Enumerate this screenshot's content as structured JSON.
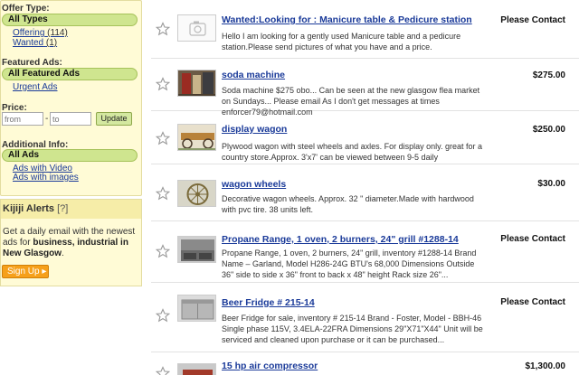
{
  "sidebar": {
    "offer_type": {
      "heading": "Offer Type:",
      "selected": "All Types",
      "options": [
        {
          "label": "Offering",
          "count": "(114)"
        },
        {
          "label": "Wanted",
          "count": "(1)"
        }
      ]
    },
    "featured_ads": {
      "heading": "Featured Ads:",
      "selected": "All Featured Ads",
      "options": [
        {
          "label": "Urgent Ads"
        }
      ]
    },
    "price": {
      "heading": "Price:",
      "from_placeholder": "from",
      "to_placeholder": "to",
      "separator": "-",
      "update_label": "Update"
    },
    "additional_info": {
      "heading": "Additional Info:",
      "selected": "All Ads",
      "options": [
        {
          "label": "Ads with Video"
        },
        {
          "label": "Ads with images"
        }
      ]
    },
    "alerts": {
      "title": "Kijiji Alerts",
      "help": "[?]",
      "text_before": "Get a daily email with the newest ads for ",
      "text_bold": "business, industrial in New Glasgow",
      "text_after": ".",
      "signup_label": "Sign Up",
      "signup_arrow": "▸"
    }
  },
  "listings": [
    {
      "title": "Wanted:Looking for : Manicure table & Pedicure station",
      "description": "Hello I am looking for a gently used Manicure table and a pedicure station.Please send pictures of what you have and a price.",
      "price": "Please Contact",
      "thumb": "placeholder-camera"
    },
    {
      "title": "soda machine",
      "description": "Soda machine $275 obo... Can be seen at the new glasgow flea market on Sundays... Please email As I don't get messages at times enforcer79@hotmail.com",
      "price": "$275.00",
      "thumb": "photo-soda-machine"
    },
    {
      "title": "display wagon",
      "description": "Plywood wagon with steel wheels and axles. For display only. great for a country store.Approx. 3'x7' can be viewed between 9-5 daily",
      "price": "$250.00",
      "thumb": "photo-display-wagon"
    },
    {
      "title": "wagon wheels",
      "description": "Decorative wagon wheels. Approx. 32 \" diameter.Made with hardwood with pvc tire. 38 units left.",
      "price": "$30.00",
      "thumb": "photo-wagon-wheel"
    },
    {
      "title": "Propane Range, 1 oven, 2 burners, 24\" grill #1288-14",
      "description": "Propane Range, 1 oven, 2 burners, 24\" grill, inventory #1288-14 Brand Name – Garland, Model H286-24G BTU's 68,000 Dimensions Outside 36\" side to side x 36\" front to back x 48\" height Rack size 26\"...",
      "price": "Please Contact",
      "thumb": "photo-propane-range"
    },
    {
      "title": "Beer Fridge # 215-14",
      "description": "Beer Fridge for sale, inventory # 215-14 Brand - Foster, Model - BBH-46 Single phase 115V, 3.4ELA-22FRA Dimensions 29\"X71\"X44\" Unit will be serviced and cleaned upon purchase or it can be purchased...",
      "price": "Please Contact",
      "thumb": "photo-beer-fridge"
    },
    {
      "title": "15 hp air compressor",
      "description": "",
      "price": "$1,300.00",
      "thumb": "photo-air-compressor"
    }
  ],
  "colors": {
    "link": "#1a3a99",
    "pill": "#cfe58f",
    "sidebar_bg": "#fffbd6",
    "signup": "#f6a01a"
  }
}
